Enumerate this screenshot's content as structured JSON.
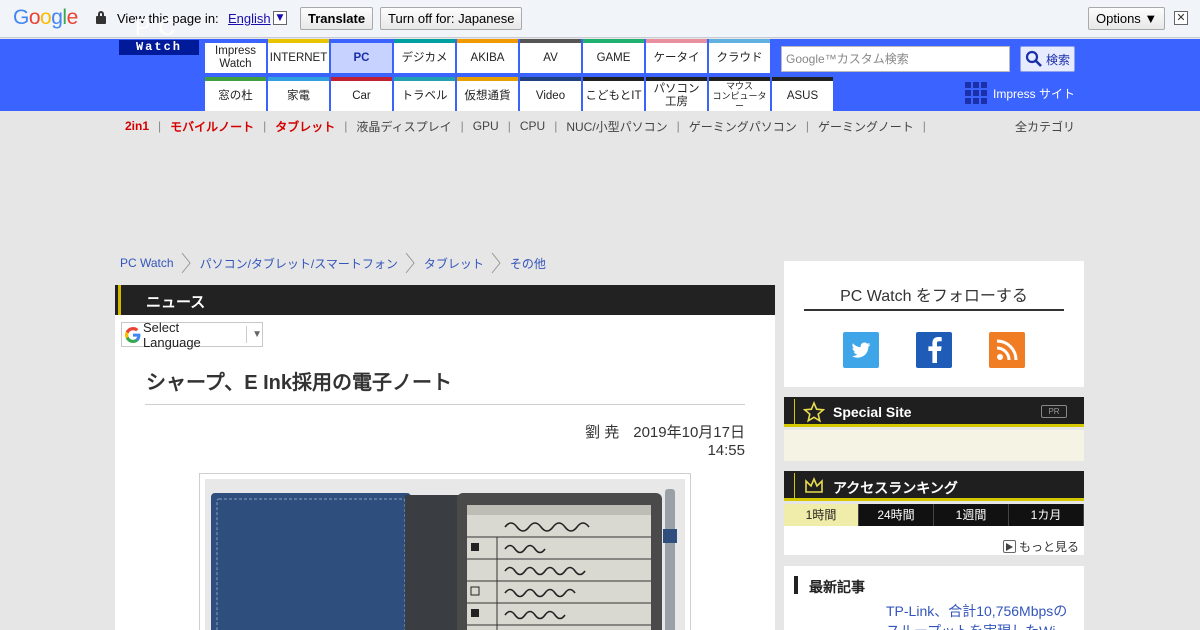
{
  "translate_bar": {
    "logo_letters": [
      {
        "ch": "G",
        "color": "#4285f4"
      },
      {
        "ch": "o",
        "color": "#ea4335"
      },
      {
        "ch": "o",
        "color": "#fbbc05"
      },
      {
        "ch": "g",
        "color": "#4285f4"
      },
      {
        "ch": "l",
        "color": "#34a853"
      },
      {
        "ch": "e",
        "color": "#ea4335"
      }
    ],
    "view_text": "View this page in:",
    "language": "English",
    "translate_label": "Translate",
    "turn_off_label": "Turn off for: Japanese",
    "options_label": "Options ▼",
    "close_glyph": "✕"
  },
  "header": {
    "logo_top": "PC",
    "logo_bottom": "Watch",
    "nav_row1": [
      {
        "label": "Impress\nWatch",
        "color": "#3a63ff"
      },
      {
        "label": "INTERNET",
        "color": "#e8c500"
      },
      {
        "label": "PC",
        "color": "#3a63ff",
        "active": true
      },
      {
        "label": "デジカメ",
        "color": "#00a0a0"
      },
      {
        "label": "AKIBA",
        "color": "#f09a00"
      },
      {
        "label": "AV",
        "color": "#555555"
      },
      {
        "label": "GAME",
        "color": "#20b070"
      },
      {
        "label": "ケータイ",
        "color": "#e890a0"
      },
      {
        "label": "クラウド",
        "color": "#60b0e0"
      }
    ],
    "nav_row2": [
      {
        "label": "窓の杜",
        "color": "#40a040"
      },
      {
        "label": "家電",
        "color": "#30a0e0"
      },
      {
        "label": "Car",
        "color": "#c02030"
      },
      {
        "label": "トラベル",
        "color": "#20a0b0"
      },
      {
        "label": "仮想通貨",
        "color": "#e8a000"
      },
      {
        "label": "Video",
        "color": "#204080"
      },
      {
        "label": "こどもとIT",
        "color": "#202020"
      },
      {
        "label": "パソコン\n工房",
        "color": "#202020"
      },
      {
        "label": "マウス\nコンピューター",
        "color": "#202020",
        "small": true
      },
      {
        "label": "ASUS",
        "color": "#202020"
      }
    ],
    "search_placeholder": "Google™カスタム検索",
    "search_button": "検索",
    "impress_site": "Impress サイト"
  },
  "subnav": {
    "items": [
      {
        "label": "2in1",
        "hot": true
      },
      {
        "label": "モバイルノート",
        "hot": true
      },
      {
        "label": "タブレット",
        "hot": true
      },
      {
        "label": "液晶ディスプレイ",
        "hot": false
      },
      {
        "label": "GPU",
        "hot": false
      },
      {
        "label": "CPU",
        "hot": false
      },
      {
        "label": "NUC/小型パソコン",
        "hot": false
      },
      {
        "label": "ゲーミングパソコン",
        "hot": false
      },
      {
        "label": "ゲーミングノート",
        "hot": false
      }
    ],
    "all_categories": "全カテゴリ"
  },
  "breadcrumb": [
    "PC Watch",
    "パソコン/タブレット/スマートフォン",
    "タブレット",
    "その他"
  ],
  "article": {
    "section": "ニュース",
    "select_language": "Select Language",
    "title": "シャープ、E Ink採用の電子ノート",
    "author": "劉 尭",
    "date": "2019年10月17日 14:55"
  },
  "sidebar": {
    "follow_title": "PC Watch をフォローする",
    "special_site": "Special Site",
    "pr_badge": "PR",
    "ranking_title": "アクセスランキング",
    "ranking_tabs": [
      "1時間",
      "24時間",
      "1週間",
      "1カ月"
    ],
    "more": "もっと見る",
    "latest_title": "最新記事",
    "latest_item": "TP-Link、合計10,756Mbpsのスループットを実現したWi"
  }
}
